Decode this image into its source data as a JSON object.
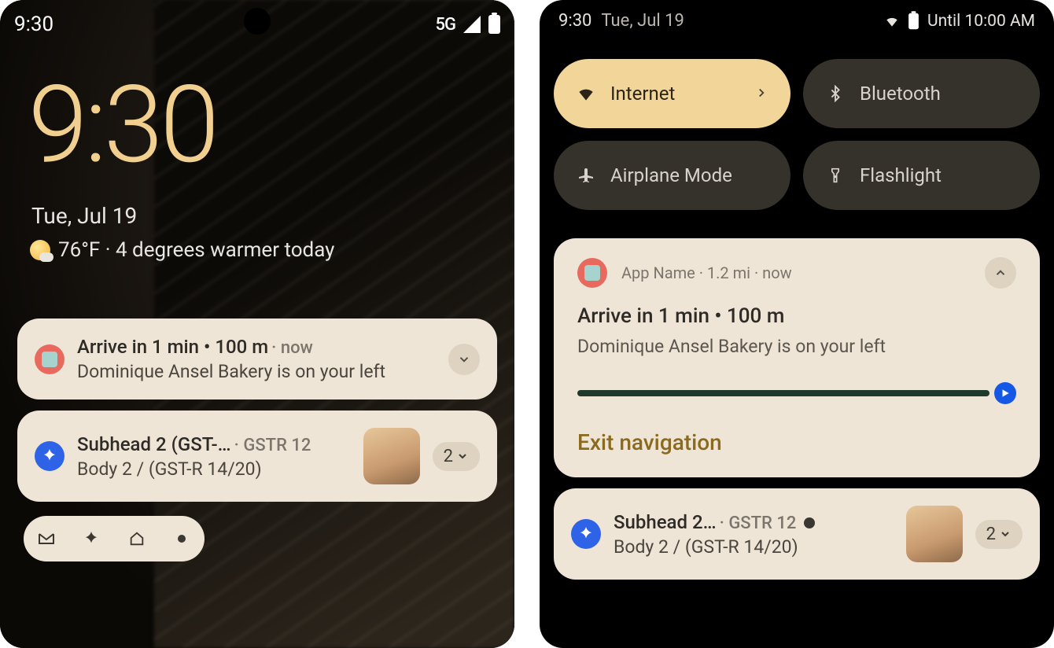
{
  "left": {
    "status_time": "9:30",
    "status_net": "5G",
    "clock": "9:30",
    "date": "Tue, Jul 19",
    "weather": "76°F · 4 degrees warmer today",
    "notif1": {
      "title": "Arrive in 1 min • 100 m",
      "meta": "· now",
      "body": "Dominique Ansel Bakery is on your left"
    },
    "notif2": {
      "subhead": "Subhead 2 (GST-…",
      "meta": "· GSTR 12",
      "body": "Body 2 / (GST-R 14/20)",
      "count": "2"
    }
  },
  "right": {
    "status_time": "9:30",
    "status_date": "Tue, Jul 19",
    "until": "Until 10:00 AM",
    "tiles": {
      "internet": "Internet",
      "bluetooth": "Bluetooth",
      "airplane": "Airplane Mode",
      "flashlight": "Flashlight"
    },
    "nav": {
      "header": "App Name · 1.2 mi · now",
      "title": "Arrive in 1 min • 100 m",
      "body": "Dominique Ansel Bakery is on your left",
      "exit": "Exit navigation"
    },
    "notif2": {
      "subhead": "Subhead 2…",
      "meta": "· GSTR 12",
      "body": "Body 2 / (GST-R 14/20)",
      "count": "2"
    }
  }
}
